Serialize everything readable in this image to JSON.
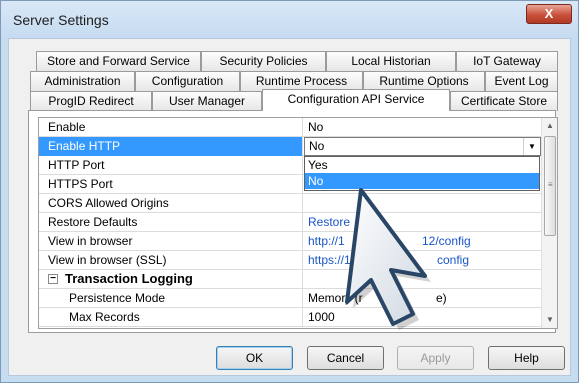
{
  "window": {
    "title": "Server Settings",
    "close_label": "X"
  },
  "tabs": {
    "row1": [
      "Store and Forward Service",
      "Security Policies",
      "Local Historian",
      "IoT Gateway"
    ],
    "row2": [
      "Administration",
      "Configuration",
      "Runtime Process",
      "Runtime Options",
      "Event Log"
    ],
    "row3": [
      "ProgID Redirect",
      "User Manager",
      "Configuration API Service",
      "Certificate Store"
    ],
    "active": "Configuration API Service"
  },
  "properties": [
    {
      "name": "Enable",
      "value": "No"
    },
    {
      "name": "Enable HTTP",
      "value": "No"
    },
    {
      "name": "HTTP Port",
      "value": ""
    },
    {
      "name": "HTTPS Port",
      "value": ""
    },
    {
      "name": "CORS Allowed Origins",
      "value": ""
    },
    {
      "name": "Restore Defaults",
      "value": "Restore"
    },
    {
      "name": "View in browser",
      "value": "http://1",
      "value_tail": "12/config"
    },
    {
      "name": "View in browser (SSL)",
      "value": "https://1",
      "value_tail": "config"
    },
    {
      "name": "Transaction Logging",
      "value": ""
    },
    {
      "name": "Persistence Mode",
      "value": "Memory (r",
      "value_tail": "e)"
    },
    {
      "name": "Max Records",
      "value": "1000"
    }
  ],
  "dropdown": {
    "options": [
      "Yes",
      "No"
    ],
    "highlighted": "No"
  },
  "buttons": {
    "ok": "OK",
    "cancel": "Cancel",
    "apply": "Apply",
    "help": "Help"
  },
  "colors": {
    "selection": "#3399ff",
    "link": "#1a56c8",
    "close": "#c8513b"
  }
}
